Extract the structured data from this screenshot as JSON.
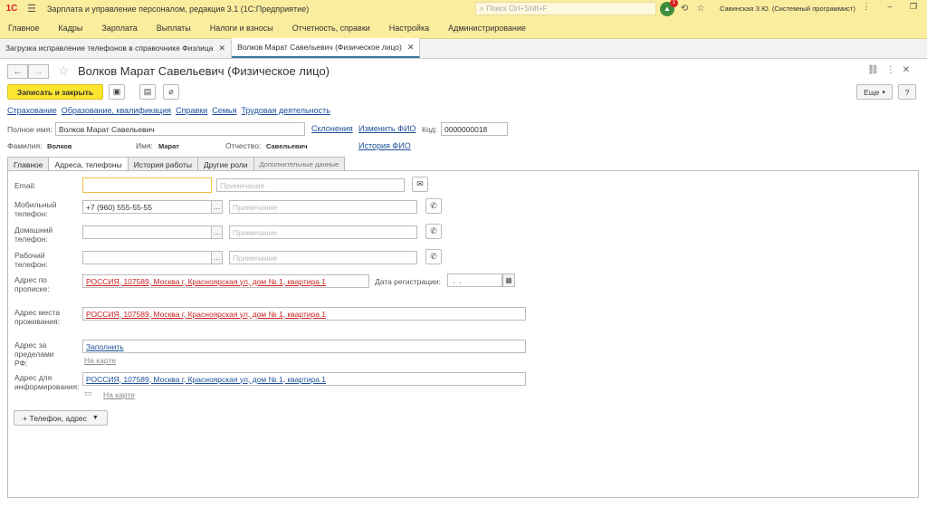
{
  "app": {
    "title": "Зарплата и управление персоналом, редакция 3.1  (1С:Предприятие)",
    "logo": "1С"
  },
  "search": {
    "placeholder": "Поиск Ctrl+Shift+F"
  },
  "notifications": {
    "count": "1"
  },
  "user": {
    "name": "Савинская З.Ю. (Системный программист)"
  },
  "menu": [
    "Главное",
    "Кадры",
    "Зарплата",
    "Выплаты",
    "Налоги и взносы",
    "Отчетность, справки",
    "Настройка",
    "Администрирование"
  ],
  "tabs": [
    {
      "label": "Загрузка исправление телефонов в справочнике Физлица"
    },
    {
      "label": "Волков Марат Савельевич (Физическое лицо)"
    }
  ],
  "form": {
    "title": "Волков Марат Савельевич (Физическое лицо)",
    "save_close": "Записать и закрыть",
    "more": "Еще",
    "help": "?",
    "links": [
      "Страхование",
      "Образование, квалификация",
      "Справки",
      "Семья",
      "Трудовая деятельность"
    ],
    "fullname_label": "Полное имя:",
    "fullname": "Волков Марат Савельевич",
    "declensions": "Склонения",
    "change_fio": "Изменить ФИО",
    "code_label": "Код:",
    "code": "0000000018",
    "surname_label": "Фамилия:",
    "surname": "Волков",
    "name_label": "Имя:",
    "name": "Марат",
    "patronymic_label": "Отчество:",
    "patronymic": "Савельевич",
    "fio_history": "История ФИО"
  },
  "page_tabs": [
    "Главное",
    "Адреса, телефоны",
    "История работы",
    "Другие роли",
    "Дополнительные данные"
  ],
  "contacts": {
    "email_label": "Email:",
    "email": "",
    "note_placeholder": "Примечание",
    "mobile_label": "Мобильный телефон:",
    "mobile": "+7 (960) 555-55-55",
    "home_label": "Домашний телефон:",
    "home": "",
    "work_label": "Рабочий телефон:",
    "work": "",
    "reg_address_label": "Адрес по прописке:",
    "reg_address": "РОССИЯ, 107589, Москва г, Красноярская ул, дом № 1, квартира 1",
    "reg_date_label": "Дата регистрации:",
    "reg_date": " .  .",
    "live_address_label": "Адрес места проживания:",
    "live_address": "РОССИЯ, 107589, Москва г, Красноярская ул, дом № 1, квартира 1",
    "abroad_label": "Адрес за пределами РФ:",
    "abroad": "Заполнить",
    "on_map": "На карте",
    "info_address_label": "Адрес для информирования:",
    "info_address": "РОССИЯ, 107589, Москва г, Красноярская ул, дом № 1, квартира 1",
    "add_button": "+ Телефон, адрес"
  }
}
